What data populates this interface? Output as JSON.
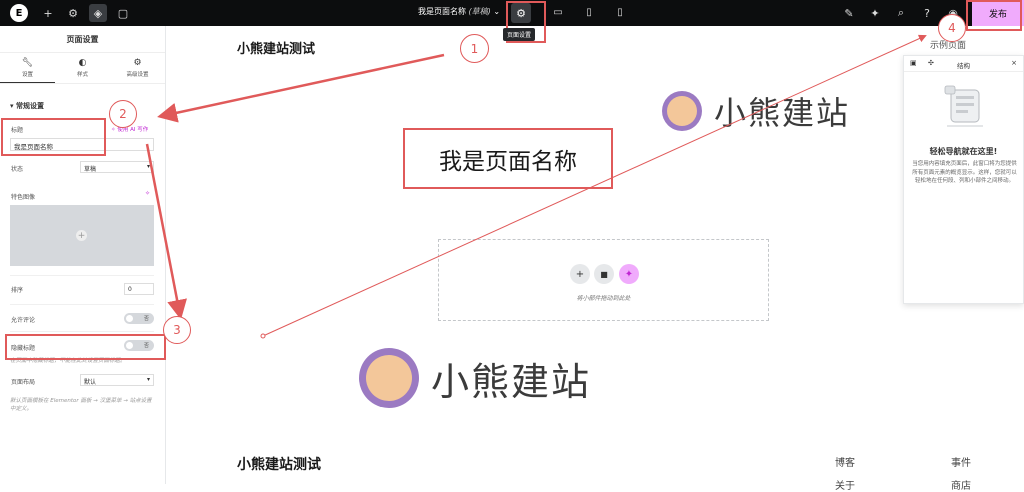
{
  "topbar": {
    "logo": "E",
    "page_name": "我是页面名称",
    "draft_tag": "(草稿)",
    "settings_tooltip": "页面设置",
    "publish_label": "发布"
  },
  "sidebar": {
    "title": "页面设置",
    "tabs": [
      {
        "label": "设置",
        "icon": "wrench-icon"
      },
      {
        "label": "样式",
        "icon": "halfcircle-icon"
      },
      {
        "label": "高级设置",
        "icon": "gear-icon"
      }
    ],
    "section_title": "常规设置",
    "title_label": "标题",
    "ai_link": "使用 AI 写作",
    "title_value": "我是页面名称",
    "status_label": "状态",
    "status_value": "草稿",
    "featured_image_label": "特色图像",
    "order_label": "排序",
    "order_value": "0",
    "comments_label": "允许评论",
    "comments_toggle": "否",
    "hide_title_label": "隐藏标题",
    "hide_title_toggle": "否",
    "hide_title_hint": "在页面中隐藏标题，不能在此处设置页面标题。",
    "layout_label": "页面布局",
    "layout_value": "默认",
    "layout_hint": "默认页面模板在 Elementor 面板 → 汉堡菜单 → 站点设置中定义。"
  },
  "canvas": {
    "site_title": "小熊建站测试",
    "page_heading": "我是页面名称",
    "dropzone_text": "将小部件拖动到此处",
    "example_page": "示例页面",
    "watermark_text": "小熊建站",
    "footer_title": "小熊建站测试",
    "footer_links": [
      "博客",
      "事件",
      "关于",
      "商店"
    ]
  },
  "navigator": {
    "title": "结构",
    "heading": "轻松导航就在这里!",
    "description": "当您用内容填充页面后，此窗口将为您提供所有页面元素的概览显示。这样，您就可以轻松地在任何段、列和小部件之间移动。"
  },
  "annotations": [
    "1",
    "2",
    "3",
    "4"
  ],
  "colors": {
    "topbar_bg": "#0c0d0e",
    "publish_bg": "#f0abfc",
    "annotation_red": "#e05a5a",
    "ai_magenta": "#c026d3"
  }
}
